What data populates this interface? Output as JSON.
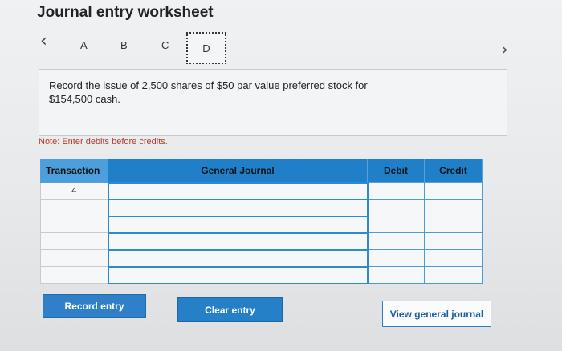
{
  "header": {
    "title": "Journal entry worksheet",
    "prev_icon": "‹",
    "next_icon": "›",
    "tabs": [
      "A",
      "B",
      "C",
      "D"
    ],
    "active_tab": "D"
  },
  "prompt": {
    "text_line1": "Record the issue of 2,500 shares of $50 par value preferred stock for",
    "text_line2": "$154,500 cash."
  },
  "note": "Note: Enter debits before credits.",
  "table": {
    "columns": {
      "transaction": "Transaction",
      "general_journal": "General Journal",
      "debit": "Debit",
      "credit": "Credit"
    },
    "rows": [
      {
        "transaction": "4",
        "account": "",
        "debit": "",
        "credit": ""
      },
      {
        "transaction": "",
        "account": "",
        "debit": "",
        "credit": ""
      },
      {
        "transaction": "",
        "account": "",
        "debit": "",
        "credit": ""
      },
      {
        "transaction": "",
        "account": "",
        "debit": "",
        "credit": ""
      },
      {
        "transaction": "",
        "account": "",
        "debit": "",
        "credit": ""
      },
      {
        "transaction": "",
        "account": "",
        "debit": "",
        "credit": ""
      }
    ]
  },
  "buttons": {
    "record": "Record entry",
    "clear": "Clear entry",
    "view": "View general journal"
  }
}
